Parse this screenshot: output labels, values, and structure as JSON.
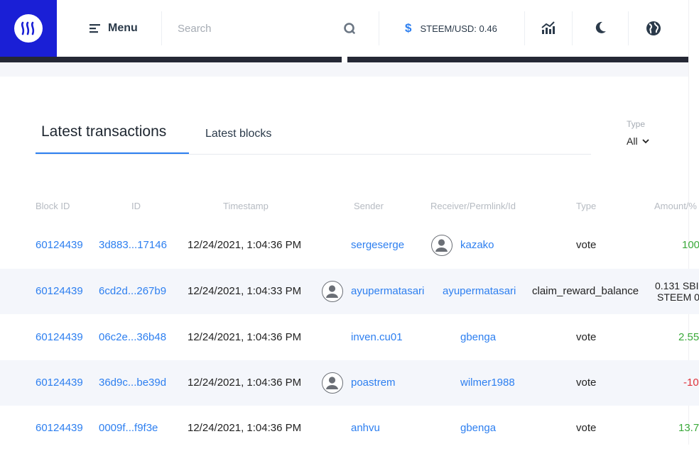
{
  "header": {
    "menu_label": "Menu",
    "search_placeholder": "Search",
    "price_label": "STEEM/USD: 0.46",
    "dollar_symbol": "$"
  },
  "tabs": {
    "active": "Latest transactions",
    "other": "Latest blocks"
  },
  "filter": {
    "label": "Type",
    "value": "All"
  },
  "table": {
    "columns": [
      "Block ID",
      "ID",
      "Timestamp",
      "Sender",
      "Receiver/Permlink/Id",
      "Type",
      "Amount/%"
    ],
    "rows": [
      {
        "block_id": "60124439",
        "id": "3d883...17146",
        "timestamp": "12/24/2021, 1:04:36 PM",
        "sender": "sergeserge",
        "receiver": "kazako",
        "type": "vote",
        "amount": "100",
        "amount_color": "green"
      },
      {
        "block_id": "60124439",
        "id": "6cd2d...267b9",
        "timestamp": "12/24/2021, 1:04:33 PM",
        "sender": "ayupermatasari",
        "receiver": "ayupermatasari",
        "type": "claim_reward_balance",
        "amount": "0.131 SBI",
        "amount2": "STEEM 0",
        "amount_color": "dark"
      },
      {
        "block_id": "60124439",
        "id": "06c2e...36b48",
        "timestamp": "12/24/2021, 1:04:36 PM",
        "sender": "inven.cu01",
        "receiver": "gbenga",
        "type": "vote",
        "amount": "2.55",
        "amount_color": "green"
      },
      {
        "block_id": "60124439",
        "id": "36d9c...be39d",
        "timestamp": "12/24/2021, 1:04:36 PM",
        "sender": "poastrem",
        "receiver": "wilmer1988",
        "type": "vote",
        "amount": "-10",
        "amount_color": "red"
      },
      {
        "block_id": "60124439",
        "id": "0009f...f9f3e",
        "timestamp": "12/24/2021, 1:04:36 PM",
        "sender": "anhvu",
        "receiver": "gbenga",
        "type": "vote",
        "amount": "13.7",
        "amount_color": "green"
      }
    ]
  }
}
